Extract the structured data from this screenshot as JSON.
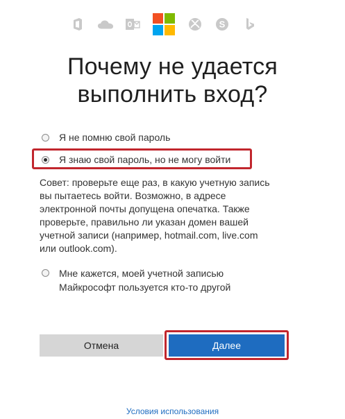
{
  "header": {
    "icons": [
      "office-icon",
      "onedrive-icon",
      "outlook-icon",
      "microsoft-logo-icon",
      "xbox-icon",
      "skype-icon",
      "bing-icon"
    ],
    "title_line1": "Почему не удается",
    "title_line2": "выполнить вход?"
  },
  "options": {
    "forgot_password": "Я не помню свой пароль",
    "know_password": "Я знаю свой пароль, но не могу войти",
    "tip": "Совет: проверьте еще раз, в какую учетную запись вы пытаетесь войти. Возможно, в адресе электронной почты допущена опечатка. Также проверьте, правильно ли указан домен вашей учетной записи (например, hotmail.com, live.com или outlook.com).",
    "someone_else_line1": "Мне кажется, моей учетной записью",
    "someone_else_line2": "Майкрософт пользуется кто-то другой"
  },
  "buttons": {
    "cancel": "Отмена",
    "next": "Далее"
  },
  "footer": {
    "terms": "Условия использования"
  },
  "colors": {
    "accent": "#1e6cc0",
    "highlight": "#c1262d",
    "cancel_bg": "#d6d6d6"
  }
}
